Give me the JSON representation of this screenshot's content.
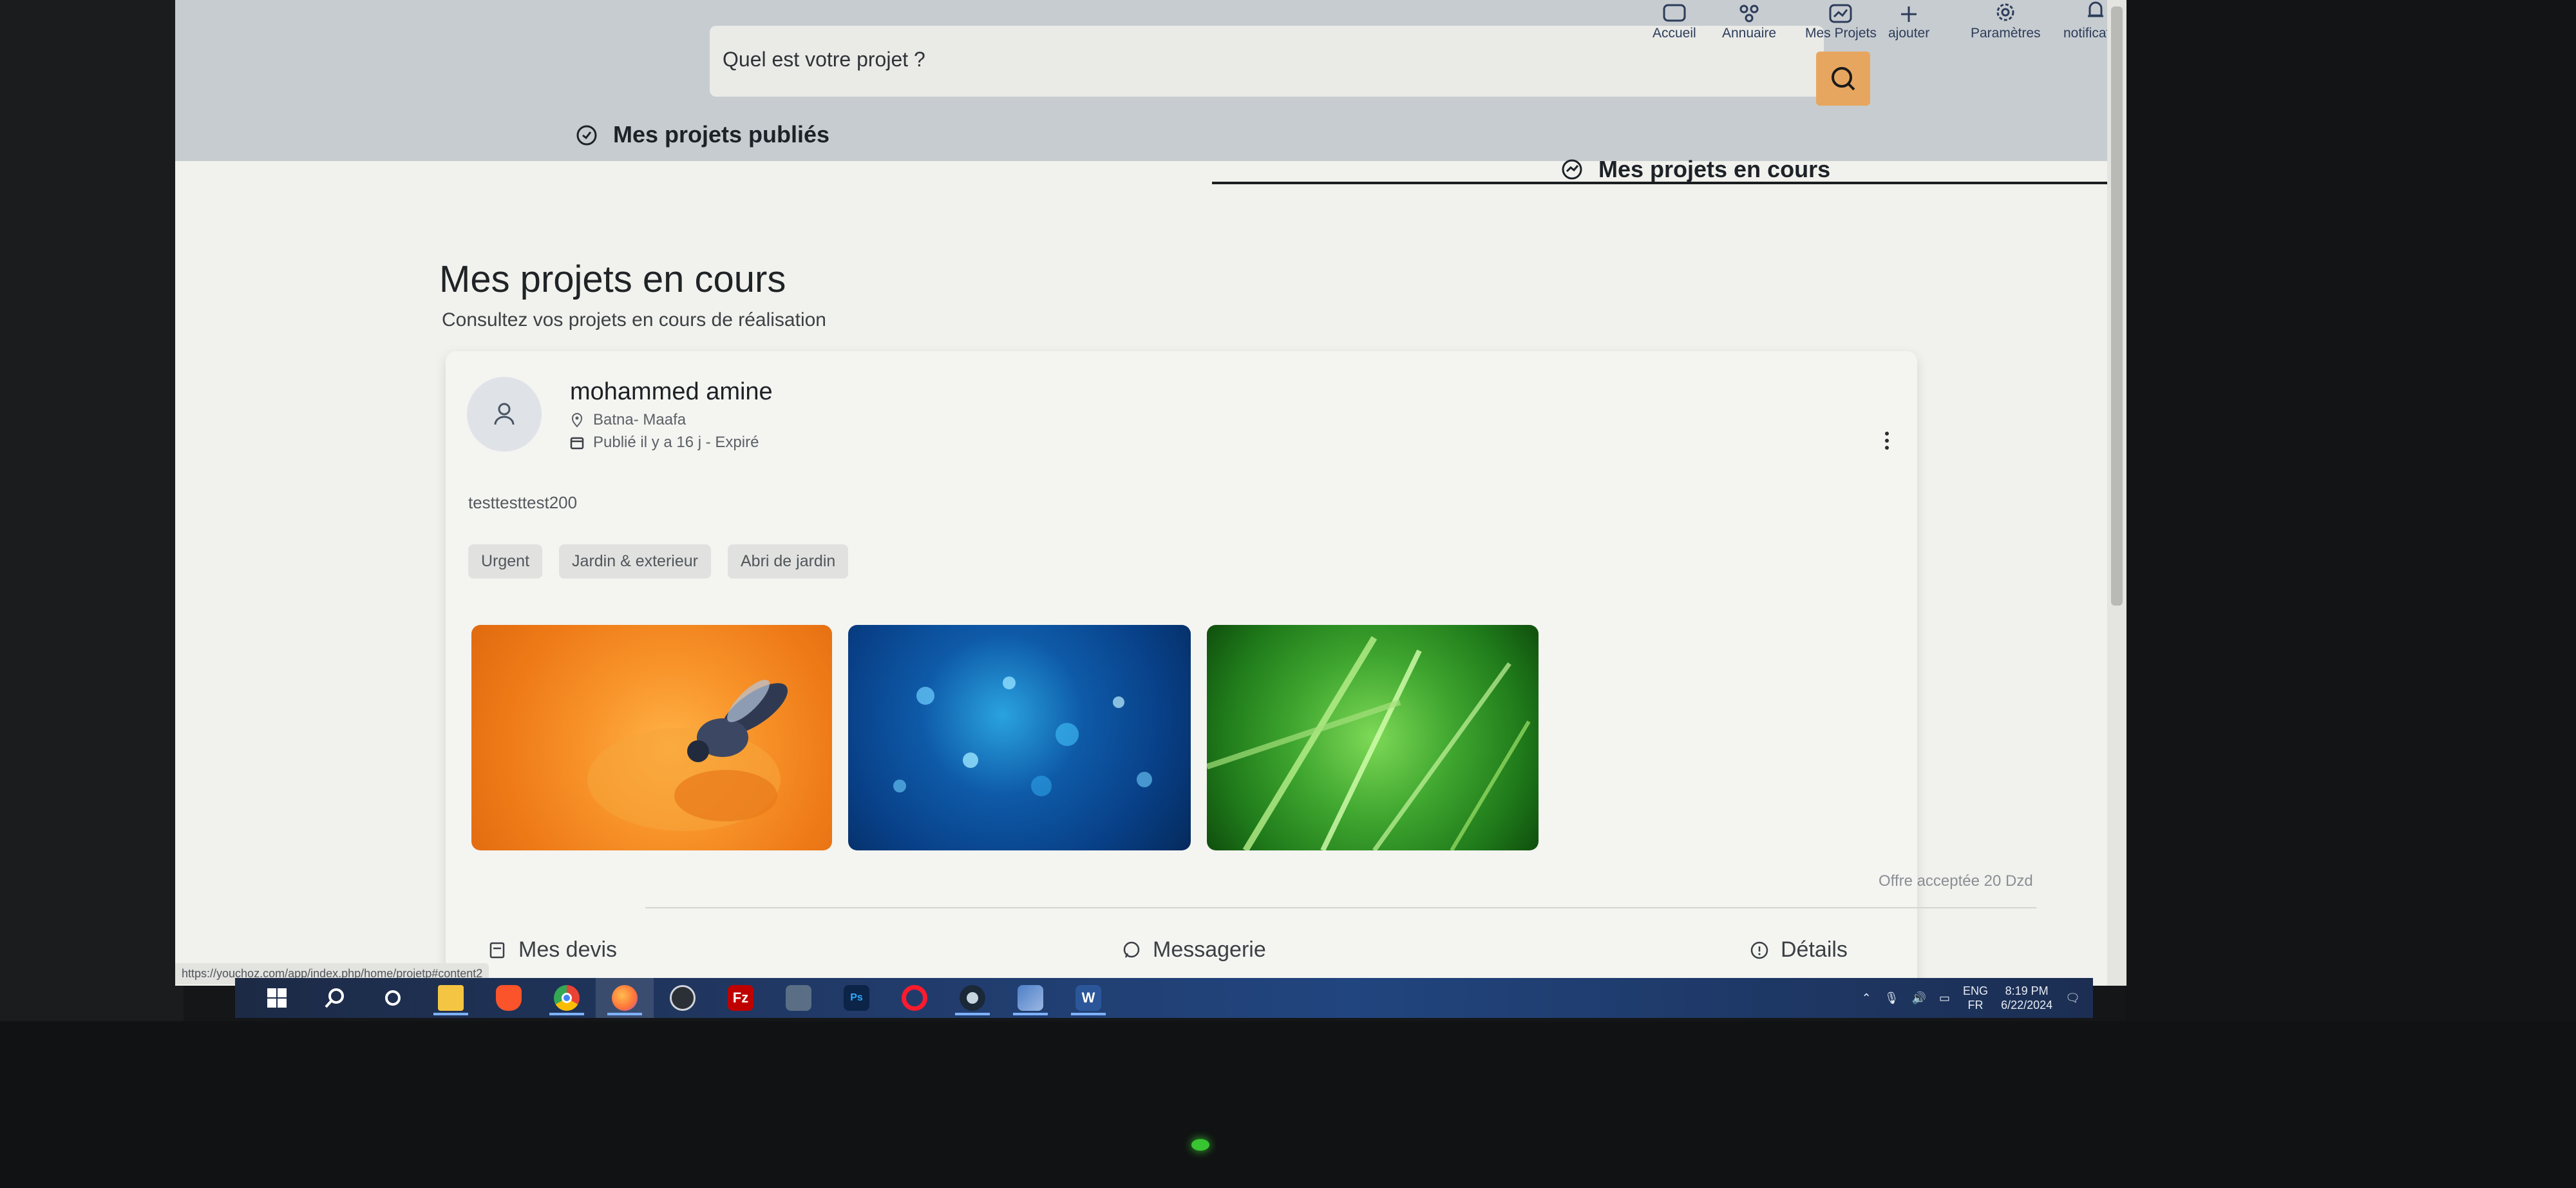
{
  "search": {
    "placeholder": "Quel est votre projet ?"
  },
  "nav": [
    {
      "label": "Accueil",
      "icon": "home-icon"
    },
    {
      "label": "Annuaire",
      "icon": "network-icon"
    },
    {
      "label": "Mes Projets",
      "icon": "chart-icon"
    },
    {
      "label": "ajouter",
      "icon": "plus-icon"
    },
    {
      "label": "Paramètres",
      "icon": "gear-icon"
    },
    {
      "label": "notification",
      "icon": "bell-icon"
    }
  ],
  "tabs": {
    "published": "Mes projets publiés",
    "current": "Mes projets en cours"
  },
  "page": {
    "title": "Mes projets en cours",
    "subtitle": "Consultez vos projets en cours de réalisation"
  },
  "project": {
    "user_name": "mohammed amine",
    "location": "Batna- Maafa",
    "published": "Publié il y a 16 j - Expiré",
    "description": "testtesttest200",
    "tags": [
      "Urgent",
      "Jardin & exterieur",
      "Abri de jardin"
    ],
    "offer": "Offre acceptée 20 Dzd",
    "actions": {
      "quotes": "Mes devis",
      "messages": "Messagerie",
      "details": "Détails"
    }
  },
  "status_url": "https://youchoz.com/app/index.php/home/projetp#content2",
  "taskbar": {
    "apps": [
      "start-icon",
      "search-icon",
      "cortana-icon",
      "file-explorer-icon",
      "brave-icon",
      "chrome-icon",
      "firefox-icon",
      "app-icon",
      "filezilla-icon",
      "app-icon",
      "photoshop-icon",
      "opera-icon",
      "steam-icon",
      "app-icon",
      "word-icon"
    ],
    "lang_top": "ENG",
    "lang_bottom": "FR",
    "time": "8:19 PM",
    "date": "6/22/2024"
  },
  "colors": {
    "accent": "#e7a65f",
    "tab_underline": "#1c1f22"
  }
}
